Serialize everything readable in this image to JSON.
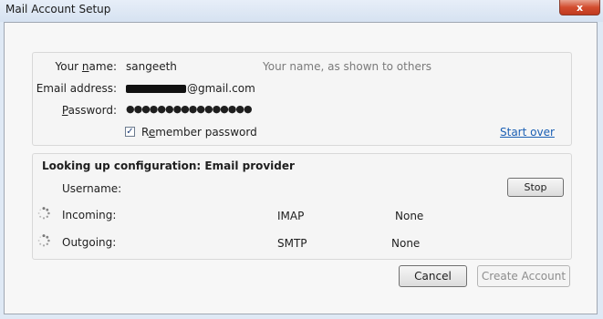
{
  "window": {
    "title": "Mail Account Setup",
    "close_label": "x"
  },
  "identity": {
    "name_label": "Your name:",
    "name_value": "sangeeth",
    "name_hint": "Your name, as shown to others",
    "email_label": "Email address:",
    "email_domain": "@gmail.com",
    "password_label": "Password:",
    "password_mask": "●●●●●●●●●●●●●●●●",
    "remember_label": "Remember password",
    "remember_checked": "✓",
    "start_over": "Start over"
  },
  "config": {
    "heading": "Looking up configuration: Email provider",
    "username_label": "Username:",
    "stop_label": "Stop",
    "incoming_label": "Incoming:",
    "incoming_protocol": "IMAP",
    "incoming_security": "None",
    "outgoing_label": "Outgoing:",
    "outgoing_protocol": "SMTP",
    "outgoing_security": "None"
  },
  "footer": {
    "cancel_label": "Cancel",
    "create_label": "Create Account"
  }
}
